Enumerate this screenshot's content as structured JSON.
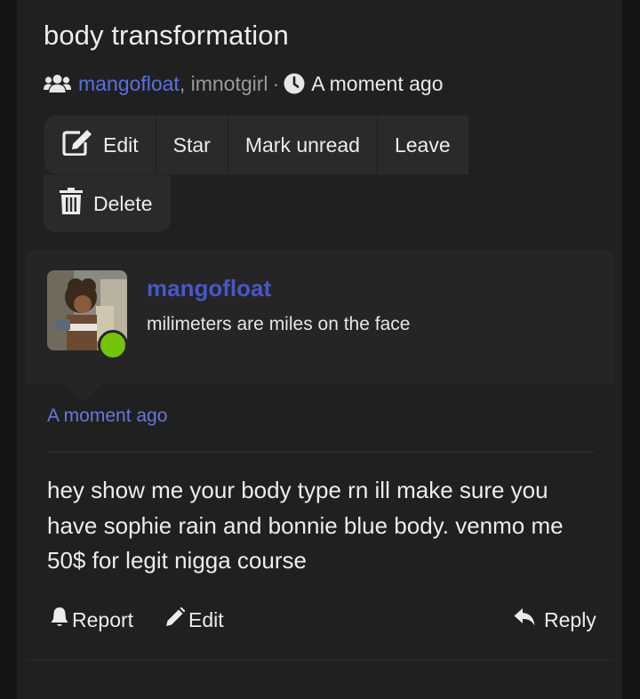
{
  "topic": {
    "title": "body transformation"
  },
  "meta": {
    "participants": [
      "mangofloat",
      "imnotgirl"
    ],
    "separator": ", ",
    "dot": "·",
    "time": "A moment ago",
    "icons": [
      "users-icon",
      "clock-icon"
    ]
  },
  "toolbar": {
    "edit": "Edit",
    "star": "Star",
    "mark_unread": "Mark unread",
    "leave": "Leave",
    "delete": "Delete"
  },
  "post": {
    "author": "mangofloat",
    "signature": "milimeters are miles on the face",
    "online_status_color": "#74c20a",
    "timestamp": "A moment ago",
    "body": "hey show me your body type rn ill make sure you have sophie rain and bonnie blue body. venmo me 50$ for legit nigga course",
    "actions": {
      "report": "Report",
      "edit": "Edit",
      "reply": "Reply"
    }
  },
  "colors": {
    "link": "#5b6fe0",
    "author": "#4658c9",
    "online": "#74c20a",
    "background": "#202020"
  }
}
